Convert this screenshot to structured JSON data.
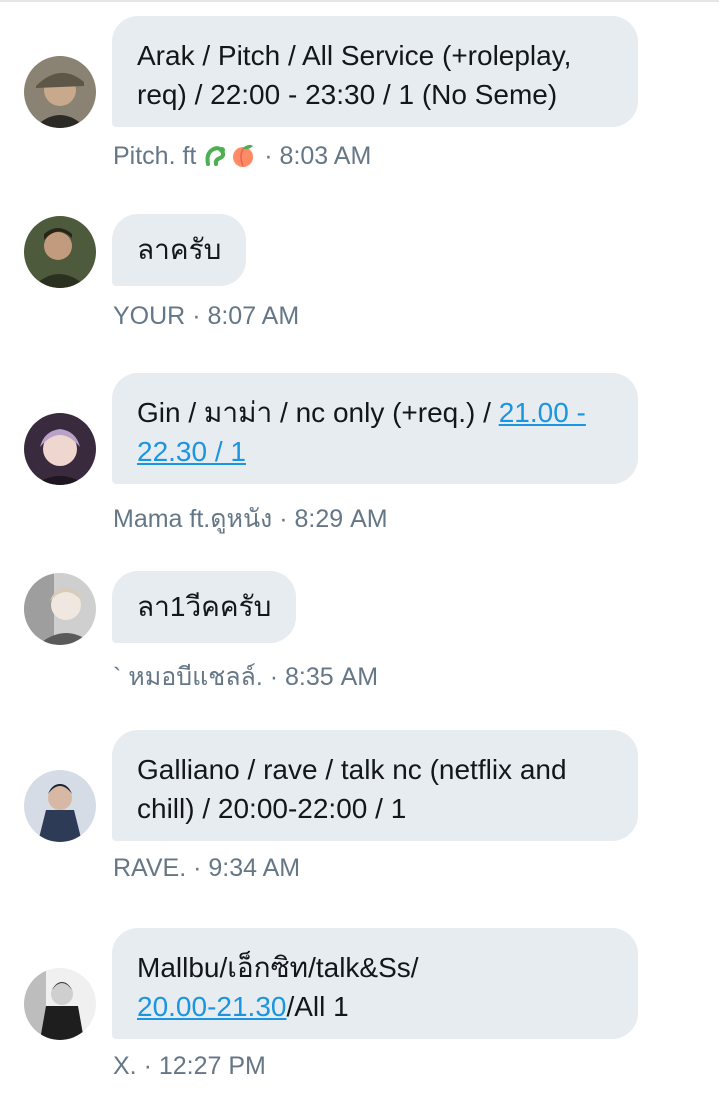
{
  "messages": [
    {
      "line1": "Arak / Pitch / All Service (+roleplay,",
      "line2": "req) / 22:00 - 23:30 / 1 (No Seme)",
      "sender": "Pitch. ft",
      "time": "· 8:03 AM",
      "avatar_colors": [
        "#6b6455",
        "#2c2a26"
      ]
    },
    {
      "text": "ลาครับ",
      "sender": "YOUR",
      "time": "· 8:07 AM",
      "avatar_colors": [
        "#5d6b4a",
        "#2a3121"
      ]
    },
    {
      "text_before_link": "Gin / มาม่า / nc only (+req.) / ",
      "link_part1": "21.00 -",
      "link_part2": "22.30 / 1",
      "sender": "Mama ft.ดูหนัง",
      "time": "· 8:29 AM",
      "avatar_colors": [
        "#c7b1c6",
        "#3a2a3d"
      ]
    },
    {
      "text": "ลา1วีคครับ",
      "sender": "` หมอบีแชลล์.",
      "time": "· 8:35 AM",
      "avatar_colors": [
        "#d9d9d9",
        "#5a5a5a"
      ]
    },
    {
      "line1": "Galliano / rave / talk nc (netflix and",
      "line2": "chill) / 20:00-22:00 / 1",
      "sender": "RAVE.",
      "time": "· 9:34 AM",
      "avatar_colors": [
        "#a9b7c8",
        "#2e3b57"
      ]
    },
    {
      "line1": "Mallbu/เอ็กซิท/talk&Ss/",
      "link": "20.00-21.30",
      "line2_after_link": "/All 1",
      "sender": "X.",
      "time": "· 12:27 PM",
      "avatar_colors": [
        "#e6e6e6",
        "#1e1e1e"
      ]
    }
  ],
  "theme": {
    "bubble_bg": "#e6ecf0",
    "text": "#14171a",
    "meta": "#657786",
    "link": "#1b95e0"
  }
}
